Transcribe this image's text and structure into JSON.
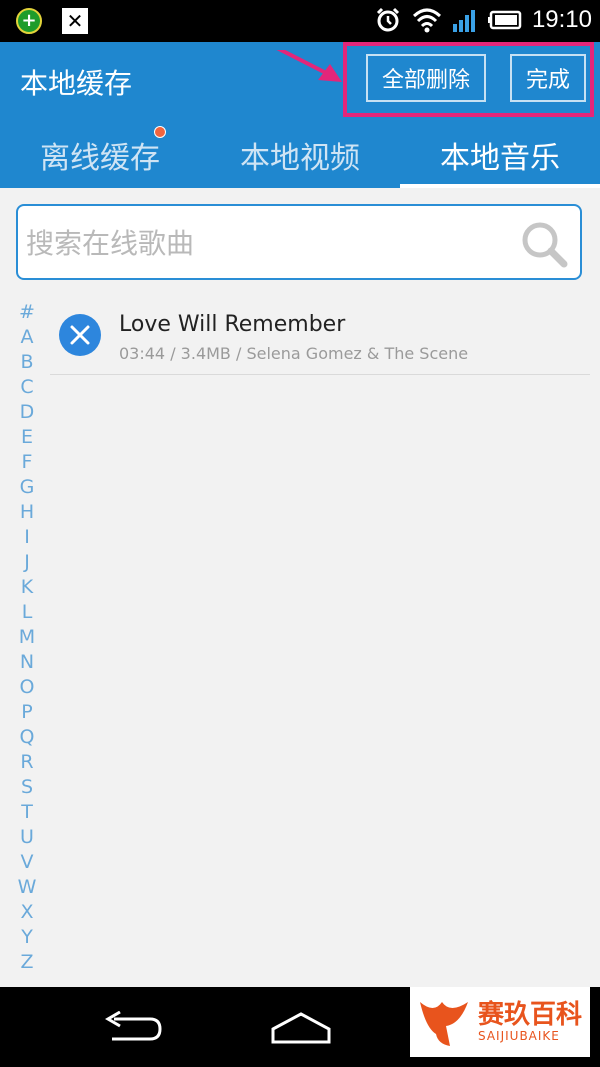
{
  "status_bar": {
    "time": "19:10"
  },
  "header": {
    "title": "本地缓存",
    "delete_all_label": "全部删除",
    "done_label": "完成",
    "tabs": [
      {
        "label": "离线缓存",
        "has_badge": true
      },
      {
        "label": "本地视频"
      },
      {
        "label": "本地音乐",
        "active": true
      }
    ]
  },
  "search": {
    "placeholder": "搜索在线歌曲",
    "value": ""
  },
  "index_letters": [
    "#",
    "A",
    "B",
    "C",
    "D",
    "E",
    "F",
    "G",
    "H",
    "I",
    "J",
    "K",
    "L",
    "M",
    "N",
    "O",
    "P",
    "Q",
    "R",
    "S",
    "T",
    "U",
    "V",
    "W",
    "X",
    "Y",
    "Z"
  ],
  "songs": [
    {
      "title": "Love Will Remember",
      "duration": "03:44",
      "size": "3.4MB",
      "artist": "Selena Gomez & The Scene"
    }
  ],
  "watermark": {
    "cn": "赛玖百科",
    "en": "SAIJIUBAIKE"
  },
  "colors": {
    "accent": "#1f87cf",
    "highlight": "#e3267a",
    "badge": "#f1653f"
  }
}
